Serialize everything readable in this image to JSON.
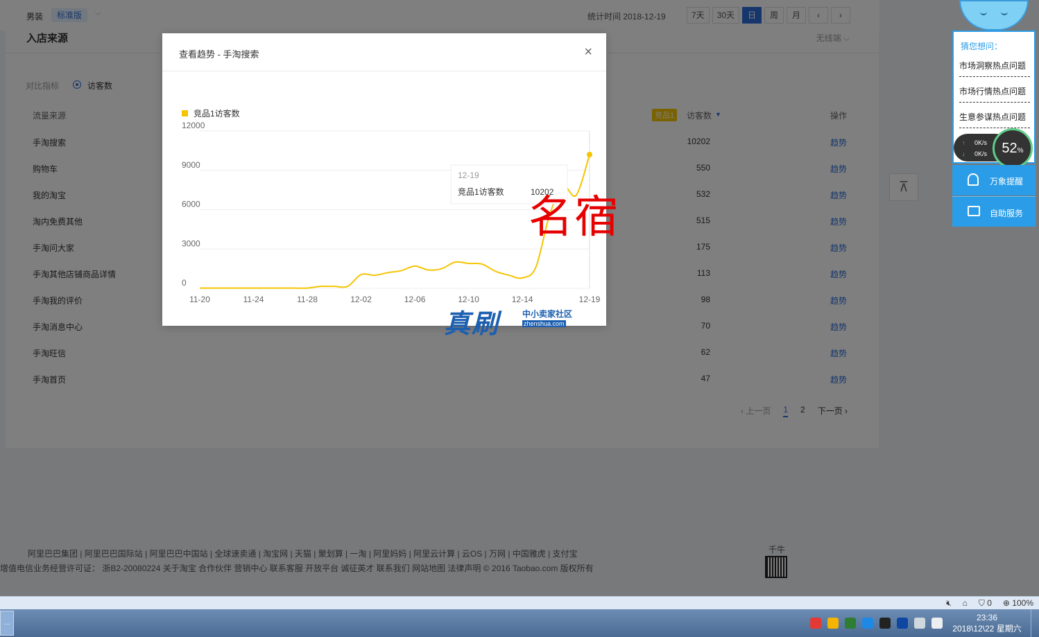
{
  "topbar": {
    "category": "男装",
    "version": "标准版",
    "stat_time": "统计时间 2018-12-19",
    "buttons": [
      "7天",
      "30天",
      "日",
      "周",
      "月",
      "‹",
      "›"
    ],
    "active_index": 2
  },
  "card": {
    "title": "入店来源",
    "terminal": "无线端 ⌵",
    "compare_label": "对比指标",
    "compare_value": "访客数",
    "headers": {
      "source": "流量来源",
      "tag": "竞品1",
      "visitors": "访客数",
      "action": "操作"
    },
    "rows": [
      {
        "source": "手淘搜索",
        "visitors": "10202",
        "action": "趋势"
      },
      {
        "source": "购物车",
        "visitors": "550",
        "action": "趋势"
      },
      {
        "source": "我的淘宝",
        "visitors": "532",
        "action": "趋势"
      },
      {
        "source": "淘内免费其他",
        "visitors": "515",
        "action": "趋势"
      },
      {
        "source": "手淘问大家",
        "visitors": "175",
        "action": "趋势"
      },
      {
        "source": "手淘其他店铺商品详情",
        "visitors": "113",
        "action": "趋势"
      },
      {
        "source": "手淘我的评价",
        "visitors": "98",
        "action": "趋势"
      },
      {
        "source": "手淘消息中心",
        "visitors": "70",
        "action": "趋势"
      },
      {
        "source": "手淘旺信",
        "visitors": "62",
        "action": "趋势"
      },
      {
        "source": "手淘首页",
        "visitors": "47",
        "action": "趋势"
      }
    ],
    "pager": {
      "prev": "‹ 上一页",
      "pages": [
        "1",
        "2"
      ],
      "next": "下一页 ›",
      "current": "1"
    }
  },
  "backtop_icon": "⊼",
  "footer": {
    "links": "阿里巴巴集团 | 阿里巴巴国际站 | 阿里巴巴中国站 | 全球速卖通 | 淘宝网 | 天猫 | 聚划算 | 一淘 | 阿里妈妈 | 阿里云计算 | 云OS | 万网 | 中国雅虎 | 支付宝",
    "license": "增值电信业务经营许可证： 浙B2-20080224  关于淘宝  合作伙伴  营销中心  联系客服  开放平台  诚征英才  联系我们  网站地图  法律声明 © 2016 Taobao.com 版权所有",
    "qianniu": "千牛"
  },
  "side_panel": {
    "head": "猜您想问：",
    "questions": [
      "市场洞察热点问题",
      "市场行情热点问题",
      "生意参谋热点问题"
    ],
    "upload": "0K/s",
    "download": "0K/s",
    "cpu": "52",
    "cpu_unit": "%",
    "remind": "万象提醒",
    "service": "自助服务"
  },
  "modal": {
    "title": "查看趋势 - 手淘搜索",
    "close": "×",
    "tooltip_date": "12-19",
    "tooltip_label": "竞品1访客数",
    "tooltip_value": "10202"
  },
  "watermarks": {
    "red": "名宿",
    "blue_big": "真刷",
    "blue_small": "中小卖家社区",
    "blue_domain": "zhenshua.com"
  },
  "statusbar": {
    "zoom": "100%",
    "count": "0"
  },
  "taskbar": {
    "time": "23:36",
    "date": "2018\\12\\22 星期六"
  },
  "chart_data": {
    "type": "line",
    "title": "",
    "legend": [
      "竞品1访客数"
    ],
    "color": "#f5c400",
    "ylim": [
      0,
      12000
    ],
    "yticks": [
      0,
      3000,
      6000,
      9000,
      12000
    ],
    "xticks": [
      "11-20",
      "11-24",
      "11-28",
      "12-02",
      "12-06",
      "12-10",
      "12-14",
      "12-19"
    ],
    "x": [
      "11-20",
      "11-21",
      "11-22",
      "11-23",
      "11-24",
      "11-25",
      "11-26",
      "11-27",
      "11-28",
      "11-29",
      "11-30",
      "12-01",
      "12-02",
      "12-03",
      "12-04",
      "12-05",
      "12-06",
      "12-07",
      "12-08",
      "12-09",
      "12-10",
      "12-11",
      "12-12",
      "12-13",
      "12-14",
      "12-15",
      "12-16",
      "12-17",
      "12-18",
      "12-19"
    ],
    "series": [
      {
        "name": "竞品1访客数",
        "values": [
          20,
          20,
          20,
          20,
          20,
          20,
          20,
          20,
          20,
          150,
          150,
          150,
          1050,
          1000,
          1200,
          1350,
          1700,
          1400,
          1500,
          2000,
          1900,
          1850,
          1300,
          1000,
          800,
          1600,
          5500,
          7800,
          7100,
          10202
        ]
      }
    ]
  }
}
